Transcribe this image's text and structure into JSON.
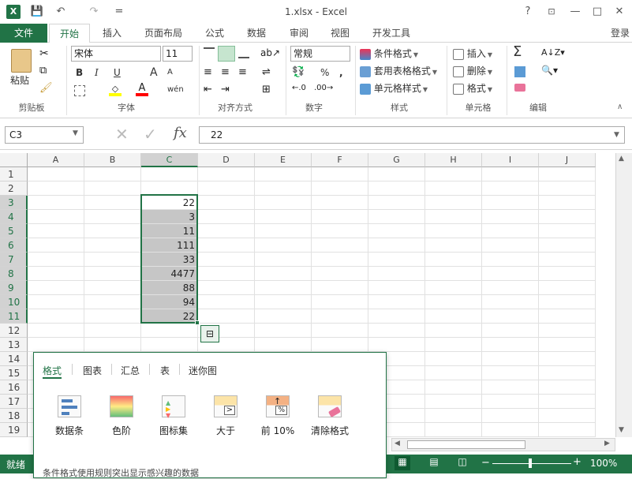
{
  "window": {
    "title": "1.xlsx - Excel",
    "help": "?",
    "minimize": "—",
    "restore": "□",
    "close": "✕"
  },
  "qat": {
    "app_icon": "X",
    "save": "💾",
    "undo": "↶",
    "redo": "↷",
    "customize": "="
  },
  "tabs": {
    "file": "文件",
    "items": [
      "开始",
      "插入",
      "页面布局",
      "公式",
      "数据",
      "审阅",
      "视图",
      "开发工具"
    ],
    "active": 0,
    "login": "登录"
  },
  "ribbon": {
    "clipboard": {
      "paste": "粘贴",
      "group": "剪贴板"
    },
    "font": {
      "name": "宋体",
      "size": "11",
      "bold": "B",
      "italic": "I",
      "underline": "U",
      "grow": "A",
      "shrink": "A",
      "wen": "wén",
      "group": "字体"
    },
    "align": {
      "group": "对齐方式"
    },
    "number": {
      "format": "常规",
      "percent": "%",
      "comma": ",",
      "group": "数字"
    },
    "styles": {
      "cond": "条件格式",
      "table": "套用表格格式",
      "cell": "单元格样式",
      "group": "样式"
    },
    "cells": {
      "insert": "插入",
      "delete": "删除",
      "format": "格式",
      "group": "单元格"
    },
    "editing": {
      "sum": "Σ",
      "group": "编辑"
    }
  },
  "formula": {
    "namebox": "C3",
    "fx": "fx",
    "value": "22"
  },
  "columns": [
    "A",
    "B",
    "C",
    "D",
    "E",
    "F",
    "G",
    "H",
    "I",
    "J"
  ],
  "rows": [
    "1",
    "2",
    "3",
    "4",
    "5",
    "6",
    "7",
    "8",
    "9",
    "10",
    "11",
    "12",
    "13",
    "14",
    "15",
    "16",
    "17",
    "18",
    "19"
  ],
  "cells_c": [
    "22",
    "3",
    "11",
    "111",
    "33",
    "4477",
    "88",
    "94",
    "22"
  ],
  "status": {
    "ready": "就绪",
    "zoom": "100%",
    "minus": "−",
    "plus": "+"
  },
  "quick_analysis": {
    "tabs": [
      "格式",
      "图表",
      "汇总",
      "表",
      "迷你图"
    ],
    "items": [
      "数据条",
      "色阶",
      "图标集",
      "大于",
      "前 10%",
      "清除格式"
    ],
    "description": "条件格式使用规则突出显示感兴趣的数据"
  },
  "colors": {
    "accent": "#217346",
    "selection": "#c6c6c6"
  }
}
